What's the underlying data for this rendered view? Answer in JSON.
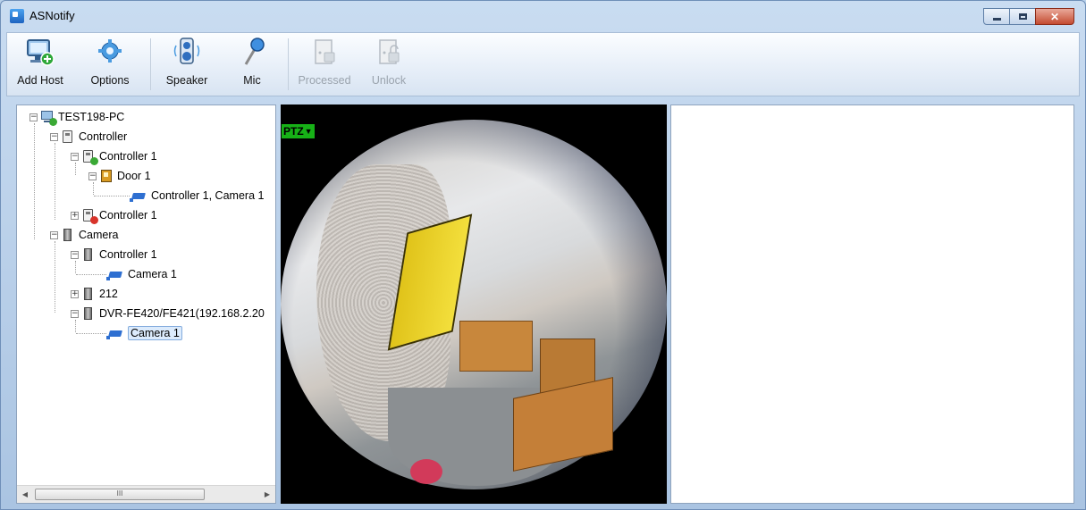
{
  "window": {
    "title": "ASNotify"
  },
  "toolbar": {
    "add_host": "Add Host",
    "options": "Options",
    "speaker": "Speaker",
    "mic": "Mic",
    "processed": "Processed",
    "unlock": "Unlock"
  },
  "tree": {
    "root": "TEST198-PC",
    "controller_group": "Controller",
    "controller_1a": "Controller 1",
    "door_1": "Door 1",
    "controller_1_camera_1": "Controller 1, Camera 1",
    "controller_1b": "Controller 1",
    "camera_group": "Camera",
    "camera_controller_1": "Controller 1",
    "camera_1a": "Camera 1",
    "dev_212": "212",
    "dvr": "DVR-FE420/FE421(192.168.2.20",
    "camera_1b": "Camera 1"
  },
  "video": {
    "ptz_label": "PTZ"
  },
  "scrollbar": {
    "grip": "III"
  },
  "colors": {
    "ptz_bg": "#17b117",
    "selection": "#dcebfc",
    "status_ok": "#3aa935",
    "status_error": "#d8332a"
  }
}
